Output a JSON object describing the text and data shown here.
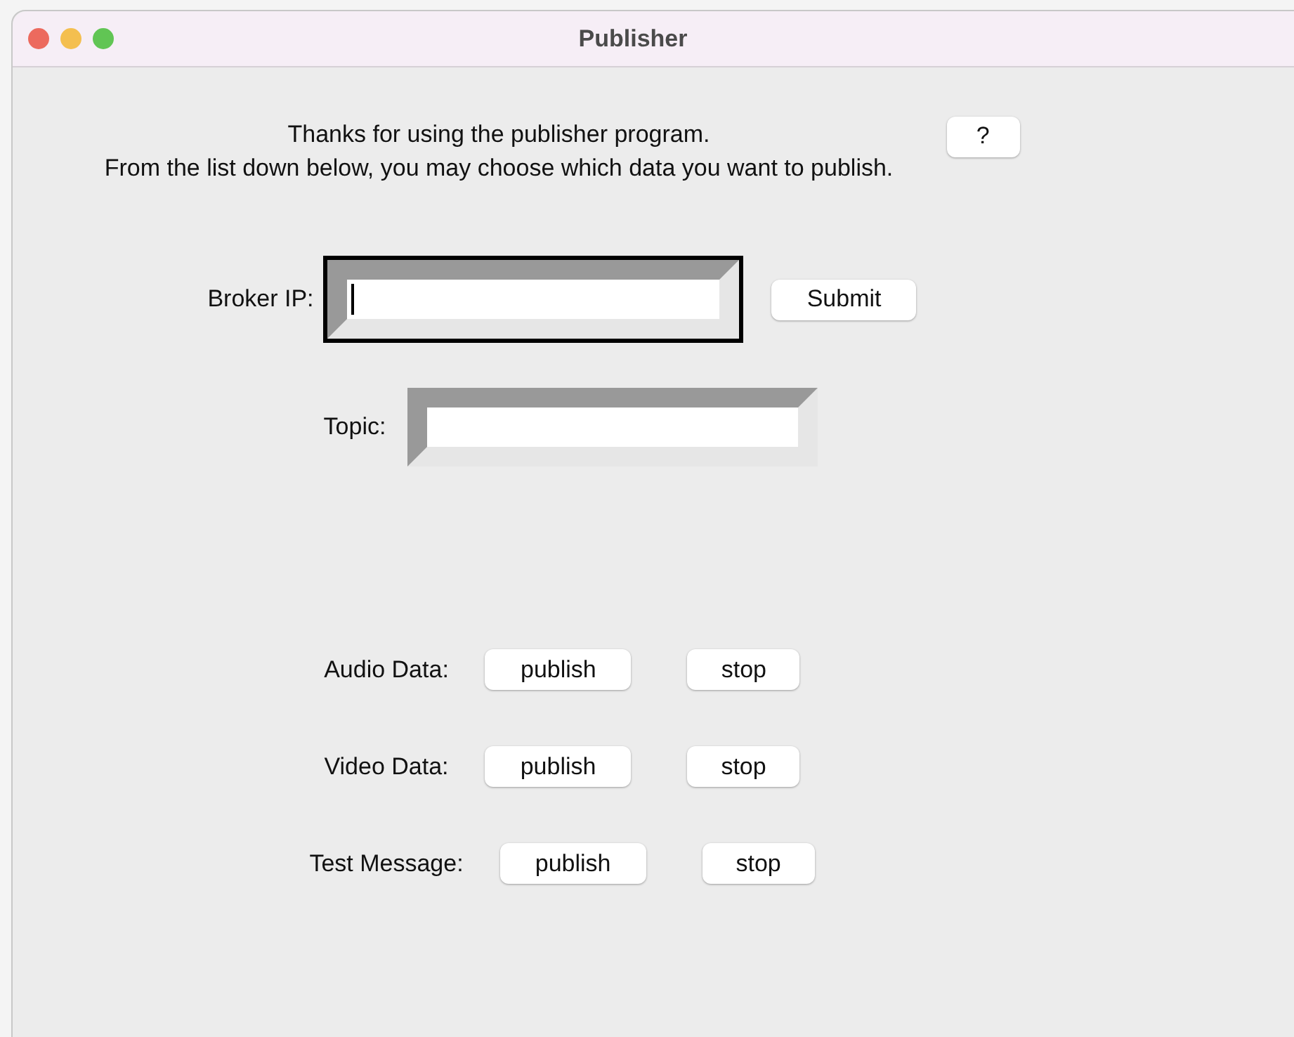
{
  "window": {
    "title": "Publisher"
  },
  "intro": {
    "lines": [
      "Thanks for using the publisher program.",
      "From the list down below, you may choose which data you want to publish."
    ],
    "help_button": "?"
  },
  "fields": [
    {
      "label": "Broker IP:",
      "focused": true,
      "button": "Submit"
    },
    {
      "label": "Topic:",
      "focused": false
    }
  ],
  "data_rows": [
    {
      "label": "Audio Data:",
      "publish": "publish",
      "stop": "stop"
    },
    {
      "label": "Video Data:",
      "publish": "publish",
      "stop": "stop"
    },
    {
      "label": "Test Message:",
      "publish": "publish",
      "stop": "stop"
    }
  ]
}
